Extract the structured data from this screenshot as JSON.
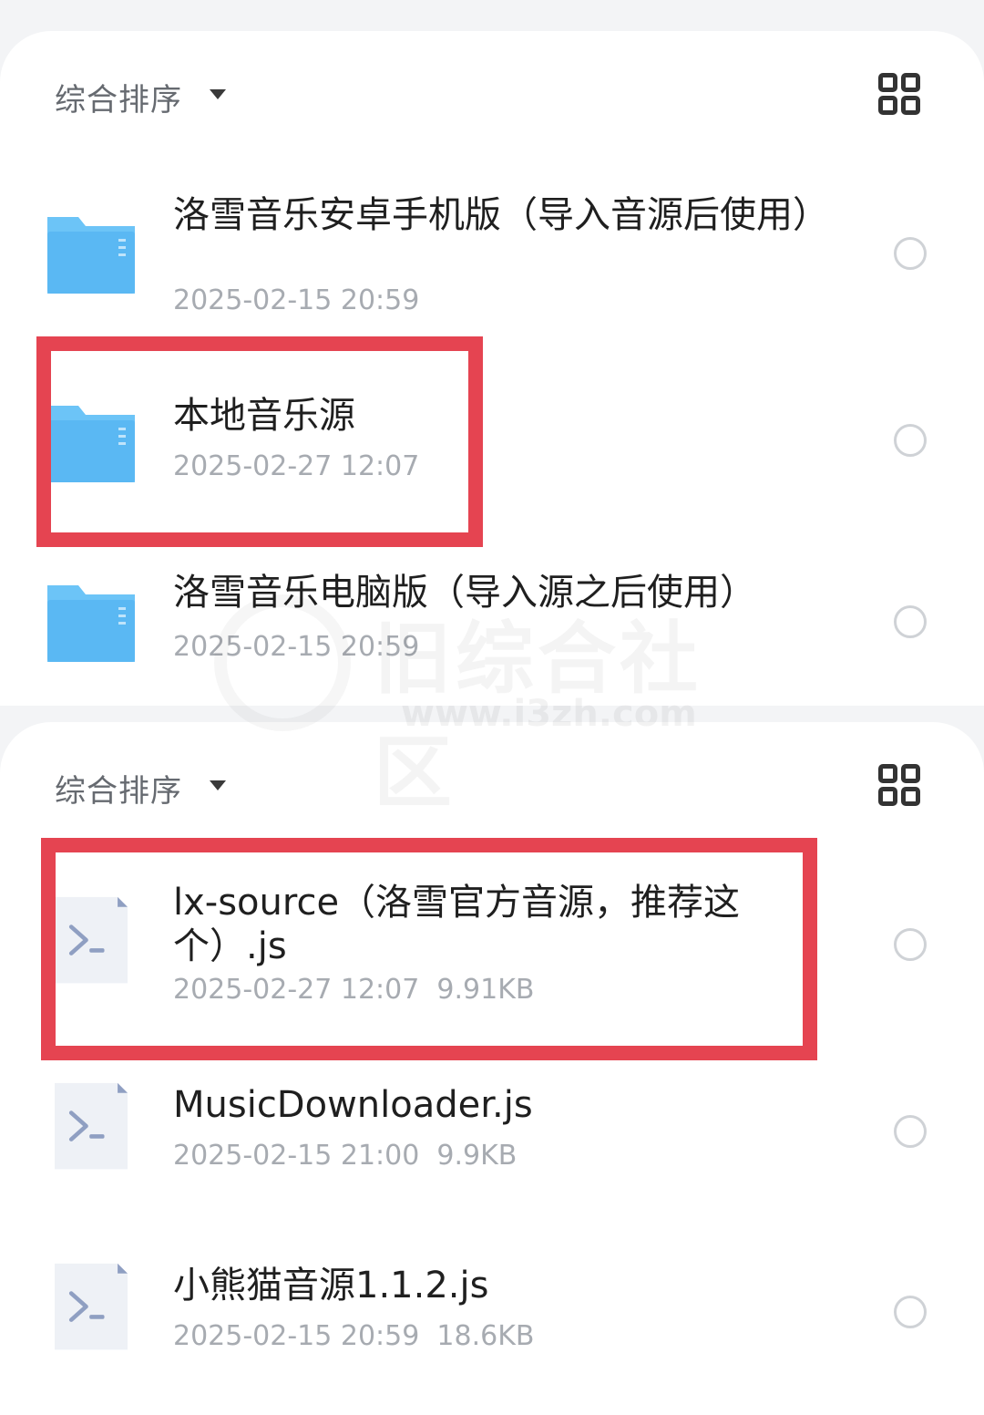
{
  "sort_label": "综合排序",
  "colors": {
    "highlight": "#e54451",
    "folder_top": "#6cc4f7",
    "folder_body": "#5ab8f3",
    "script_icon": "#8f9fc2"
  },
  "icons": {
    "folder": "folder-icon",
    "script": "script-file-icon",
    "grid": "grid-view-icon",
    "caret": "caret-down-icon"
  },
  "folders": [
    {
      "name": "洛雪音乐安卓手机版（导入音源后使用）",
      "date": "2025-02-15 20:59"
    },
    {
      "name": "本地音乐源",
      "date": "2025-02-27 12:07"
    },
    {
      "name": "洛雪音乐电脑版（导入源之后使用）",
      "date": "2025-02-15 20:59"
    }
  ],
  "files": [
    {
      "name": "lx-source（洛雪官方音源，推荐这个）.js",
      "meta": "2025-02-27 12:07  9.91KB"
    },
    {
      "name": "MusicDownloader.js",
      "meta": "2025-02-15 21:00  9.9KB"
    },
    {
      "name": "小熊猫音源1.1.2.js",
      "meta": "2025-02-15 20:59  18.6KB"
    }
  ],
  "watermark": {
    "title": "旧综合社区",
    "url": "www.i3zh.com"
  }
}
